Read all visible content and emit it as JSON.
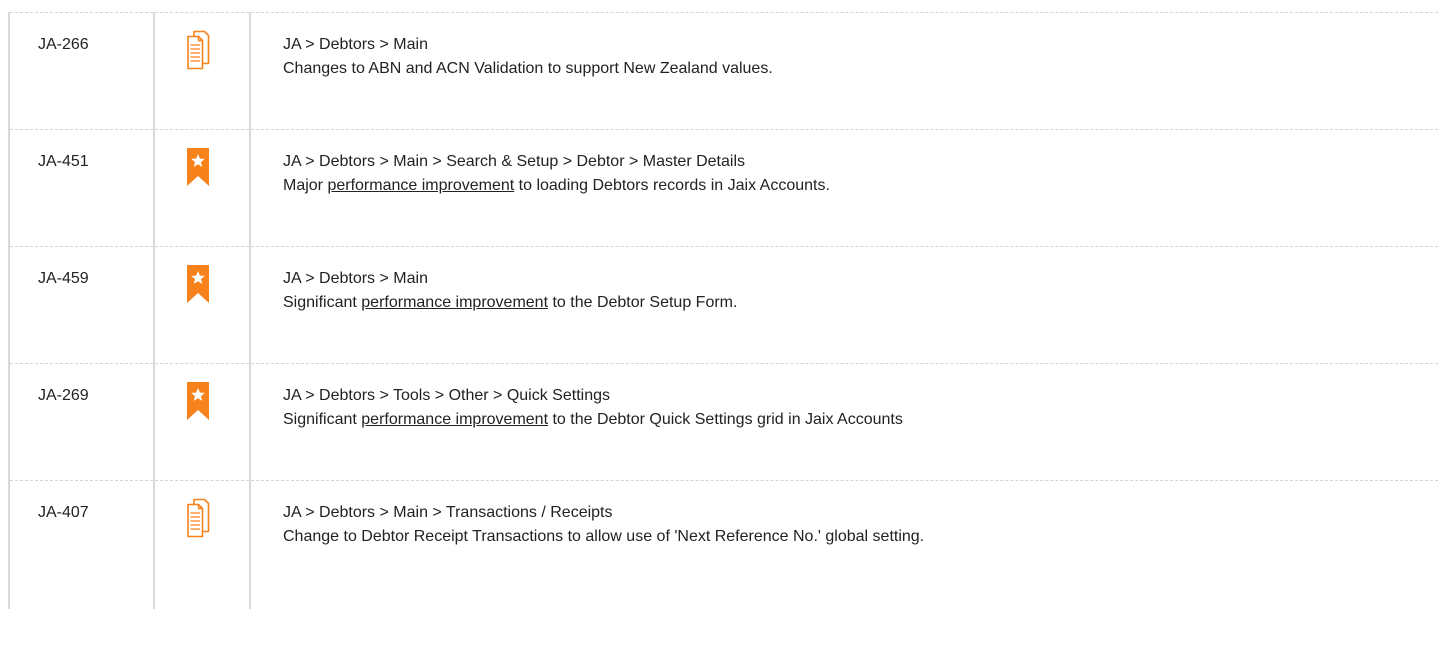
{
  "colors": {
    "accent": "#f7821b",
    "text": "#222222",
    "border": "#d9d9d9"
  },
  "rows": [
    {
      "id": "JA-266",
      "icon": "document-icon",
      "path": "JA > Debtors > Main",
      "text_before": "Changes to ABN and ACN Validation to support New Zealand values.",
      "link": "",
      "text_after": ""
    },
    {
      "id": "JA-451",
      "icon": "star-bookmark-icon",
      "path": "JA > Debtors > Main > Search & Setup > Debtor > Master Details",
      "text_before": "Major ",
      "link": "performance improvement",
      "text_after": " to loading Debtors records in Jaix Accounts."
    },
    {
      "id": "JA-459",
      "icon": "star-bookmark-icon",
      "path": "JA > Debtors > Main",
      "text_before": "Significant ",
      "link": "performance improvement",
      "text_after": " to the Debtor Setup Form."
    },
    {
      "id": "JA-269",
      "icon": "star-bookmark-icon",
      "path": "JA > Debtors > Tools > Other > Quick Settings",
      "text_before": "Significant ",
      "link": "performance improvement",
      "text_after": " to the Debtor Quick Settings grid in Jaix Accounts"
    },
    {
      "id": "JA-407",
      "icon": "document-icon",
      "path": "JA > Debtors > Main > Transactions / Receipts",
      "text_before": "Change to Debtor Receipt Transactions to allow use of 'Next Reference No.' global setting.",
      "link": "",
      "text_after": ""
    }
  ]
}
